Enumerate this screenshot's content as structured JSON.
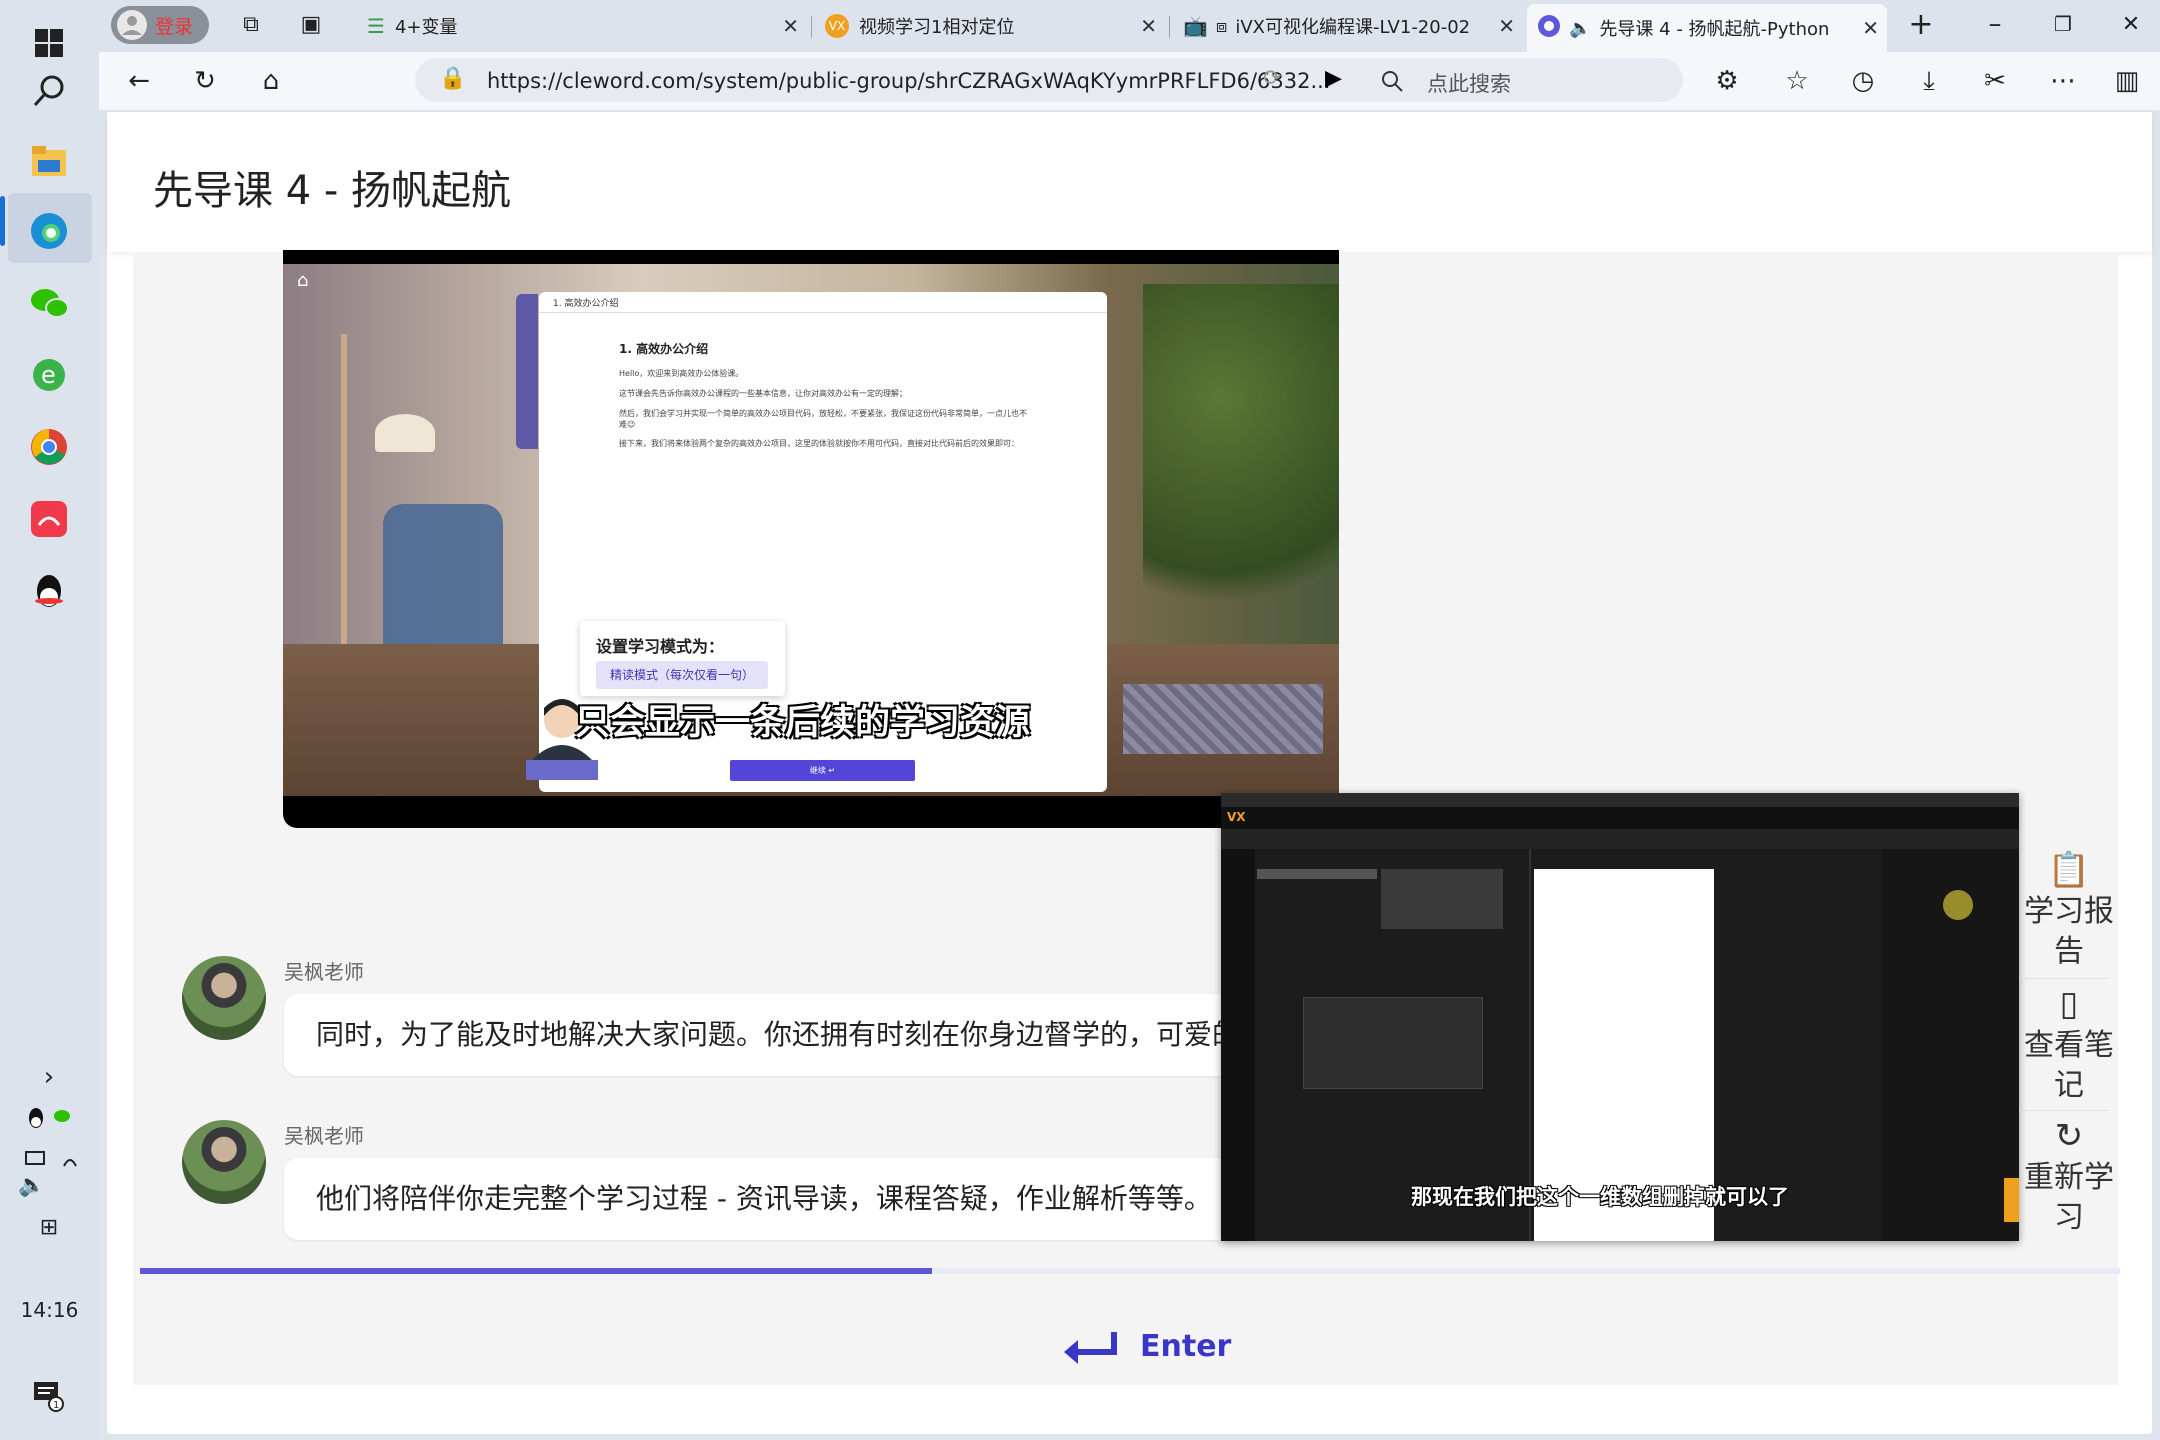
{
  "browser": {
    "login_label": "登录",
    "tabs": [
      {
        "title": "4+变量"
      },
      {
        "title": "视频学习1相对定位"
      },
      {
        "title": "iVX可视化编程课-LV1-20-02"
      },
      {
        "title": "先导课 4 - 扬帆起航-Python"
      }
    ],
    "url": "https://cleword.com/system/public-group/shrCZRAGxWAqKYymrPRFLFD6/6332...",
    "search_placeholder": "点此搜索"
  },
  "taskbar": {
    "clock": "14:16"
  },
  "page": {
    "title": "先导课 4 - 扬帆起航"
  },
  "video_main": {
    "doc_tab": "1. 高效办公介绍",
    "doc_heading": "1. 高效办公介绍",
    "doc_paragraphs": [
      "Hello，欢迎来到高效办公体验课。",
      "这节课会先告诉你高效办公课程的一些基本信息，让你对高效办公有一定的理解；",
      "然后，我们会学习并实现一个简单的高效办公项目代码，放轻松，不要紧张，我保证这份代码非常简单，一点儿也不难😉",
      "接下来，我们将来体验两个复杂的高效办公项目，这里的体验就按你不用可代码，直接对比代码前后的效果即可："
    ],
    "mode_title": "设置学习模式为：",
    "mode_button": "精读模式（每次仅看一句）",
    "continue_label": "继续 ↵",
    "caption": "只会显示一条后续的学习资源"
  },
  "chat": [
    {
      "sender": "吴枫老师",
      "text": "同时，为了能及时地解决大家问题。你还拥有时刻在你身边督学的，可爱的"
    },
    {
      "sender": "吴枫老师",
      "text": "他们将陪伴你走完整个学习过程 - 资讯导读，课程答疑，作业解析等等。"
    }
  ],
  "progress": {
    "fraction": 0.4
  },
  "enter_label": "Enter",
  "pip_video": {
    "caption": "那现在我们把这个一维数组删掉就可以了"
  },
  "side_panel": {
    "items": [
      {
        "label": "学习报告",
        "icon": "clipboard-icon"
      },
      {
        "label": "查看笔记",
        "icon": "notebook-icon"
      },
      {
        "label": "重新学习",
        "icon": "refresh-icon"
      }
    ]
  },
  "colors": {
    "accent": "#5c58d8",
    "enter": "#3a37c8"
  }
}
